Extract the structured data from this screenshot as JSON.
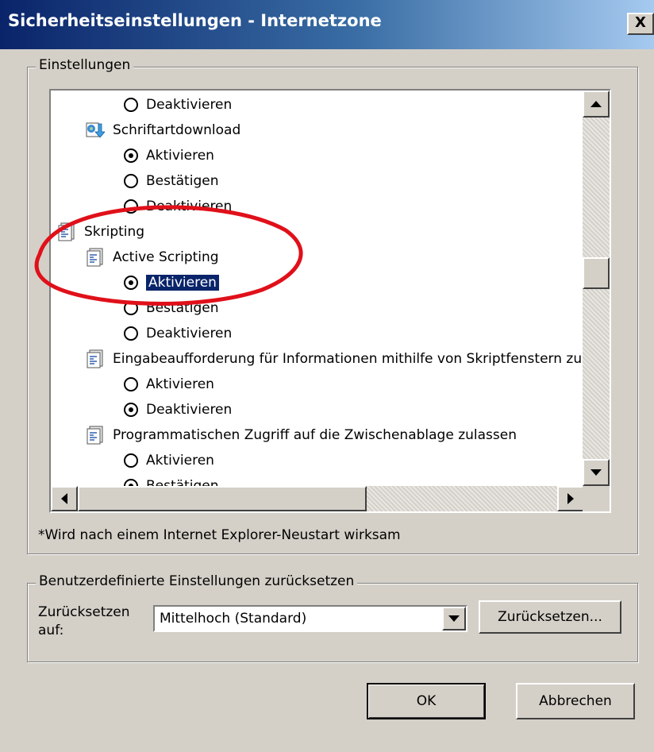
{
  "window": {
    "title": "Sicherheitseinstellungen - Internetzone",
    "close_label": "X"
  },
  "settings": {
    "legend": "Einstellungen",
    "items": [
      {
        "type": "radio",
        "label": "Deaktivieren",
        "checked": false
      },
      {
        "type": "category",
        "icon": "font-download-icon",
        "label": "Schriftartdownload"
      },
      {
        "type": "radio",
        "label": "Aktivieren",
        "checked": true
      },
      {
        "type": "radio",
        "label": "Bestätigen",
        "checked": false
      },
      {
        "type": "radio",
        "label": "Deaktivieren",
        "checked": false
      },
      {
        "type": "category",
        "icon": "script-icon",
        "label": "Skripting"
      },
      {
        "type": "category",
        "icon": "script-icon",
        "label": "Active Scripting"
      },
      {
        "type": "radio",
        "label": "Aktivieren",
        "checked": true,
        "selected": true
      },
      {
        "type": "radio",
        "label": "Bestätigen",
        "checked": false
      },
      {
        "type": "radio",
        "label": "Deaktivieren",
        "checked": false
      },
      {
        "type": "category",
        "icon": "script-icon",
        "label": "Eingabeaufforderung für Informationen mithilfe von Skriptfenstern zulassen"
      },
      {
        "type": "radio",
        "label": "Aktivieren",
        "checked": false
      },
      {
        "type": "radio",
        "label": "Deaktivieren",
        "checked": true
      },
      {
        "type": "category",
        "icon": "script-icon",
        "label": "Programmatischen Zugriff auf die Zwischenablage zulassen"
      },
      {
        "type": "radio",
        "label": "Aktivieren",
        "checked": false
      },
      {
        "type": "radio",
        "label": "Bestätigen",
        "checked": true
      }
    ],
    "footnote": "*Wird nach einem Internet Explorer-Neustart wirksam"
  },
  "reset": {
    "legend": "Benutzerdefinierte Einstellungen zurücksetzen",
    "label": "Zurücksetzen auf:",
    "selected_level": "Mittelhoch (Standard)",
    "reset_button": "Zurücksetzen..."
  },
  "buttons": {
    "ok": "OK",
    "cancel": "Abbrechen"
  },
  "colors": {
    "dialog_bg": "#d4d0c8",
    "selection_bg": "#0a246a",
    "annotation_red": "#e0101a"
  }
}
